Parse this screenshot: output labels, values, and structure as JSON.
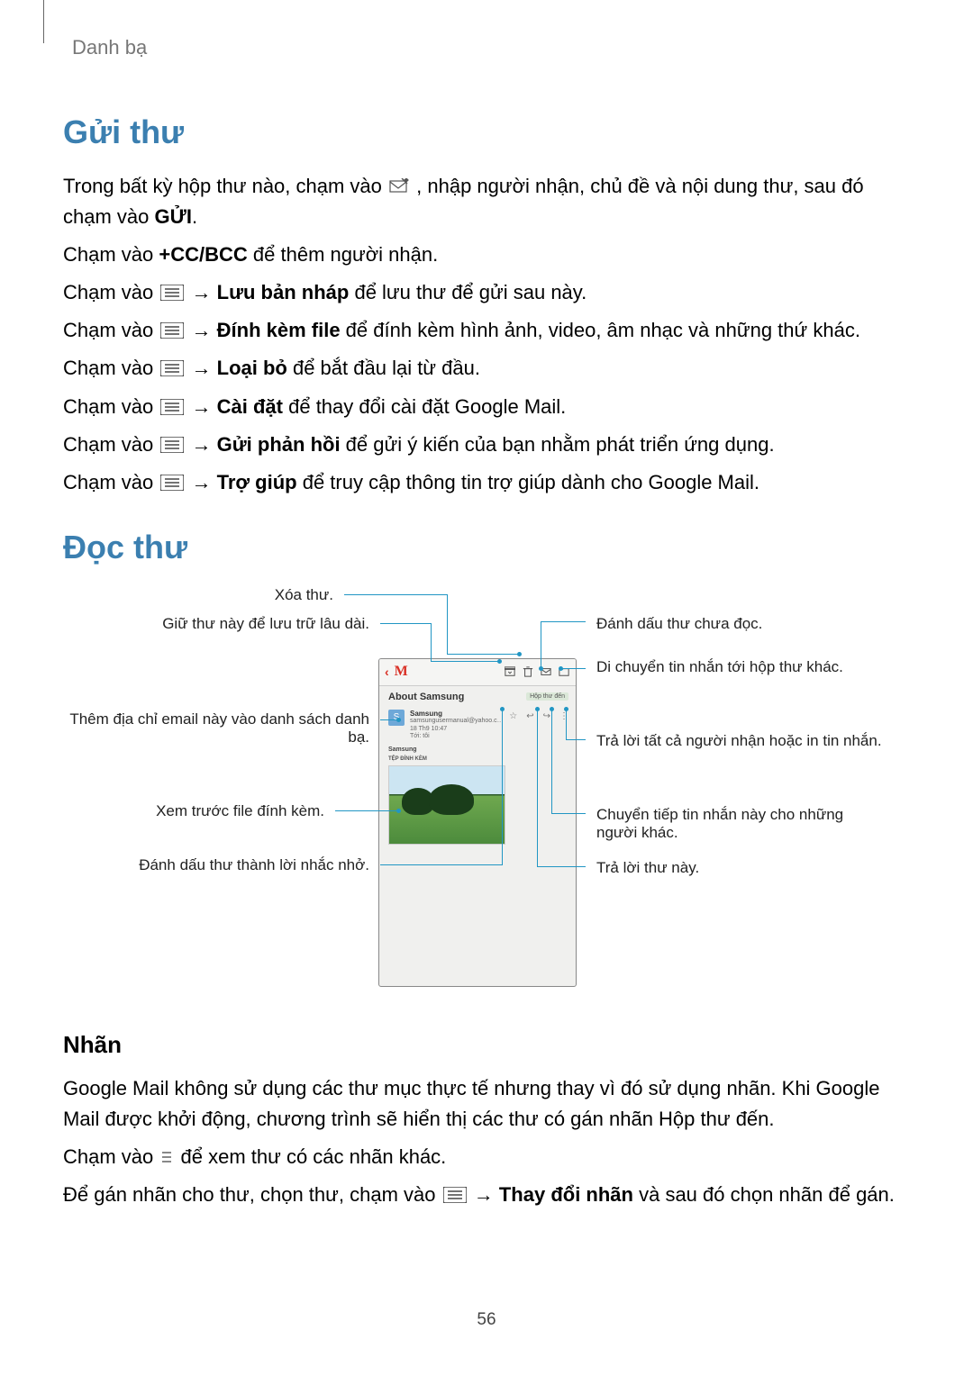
{
  "breadcrumb": "Danh bạ",
  "section1_title": "Gửi thư",
  "s1_p1a": "Trong bất kỳ hộp thư nào, chạm vào ",
  "s1_p1b": ", nhập người nhận, chủ đề và nội dung thư, sau đó chạm vào ",
  "s1_p1c": "GỬI",
  "s1_p1d": ".",
  "s1_p2a": "Chạm vào ",
  "s1_p2b": "+CC/BCC",
  "s1_p2c": " để thêm người nhận.",
  "s1_p3a": "Chạm vào ",
  "arrow": " → ",
  "s1_p3b": "Lưu bản nháp",
  "s1_p3c": " để lưu thư để gửi sau này.",
  "s1_p4b": "Đính kèm file",
  "s1_p4c": " để đính kèm hình ảnh, video, âm nhạc và những thứ khác.",
  "s1_p5b": "Loại bỏ",
  "s1_p5c": " để bắt đầu lại từ đầu.",
  "s1_p6b": "Cài đặt",
  "s1_p6c": " để thay đổi cài đặt Google Mail.",
  "s1_p7b": "Gửi phản hồi",
  "s1_p7c": " để gửi ý kiến của bạn nhằm phát triển ứng dụng.",
  "s1_p8b": "Trợ giúp",
  "s1_p8c": " để truy cập thông tin trợ giúp dành cho Google Mail.",
  "section2_title": "Đọc thư",
  "callouts": {
    "l1": "Xóa thư.",
    "l2": "Giữ thư này để lưu trữ lâu dài.",
    "l3": "Thêm địa chỉ email này vào danh sách danh bạ.",
    "l4": "Xem trước file đính kèm.",
    "l5": "Đánh dấu thư thành lời nhắc nhở.",
    "r1": "Đánh dấu thư chưa đọc.",
    "r2": "Di chuyển tin nhắn tới hộp thư khác.",
    "r3": "Trả lời tất cả người nhận hoặc in tin nhắn.",
    "r4": "Chuyển tiếp tin nhắn này cho những người khác.",
    "r5": "Trả lời thư này."
  },
  "phone": {
    "subject": "About Samsung",
    "inbox_chip": "Hộp thư đến",
    "sender_name": "Samsung",
    "sender_email": "samsungusermanual@yahoo.c…",
    "sender_date": "18 Th9 10:47",
    "sender_to": "Tới: tôi",
    "body_line1": "Samsung",
    "attach_label": "TỆP ĐÍNH KÈM"
  },
  "section3_title": "Nhãn",
  "s3_p1": "Google Mail không sử dụng các thư mục thực tế nhưng thay vì đó sử dụng nhãn. Khi Google Mail được khởi động, chương trình sẽ hiển thị các thư có gán nhãn Hộp thư đến.",
  "s3_p2a": "Chạm vào ",
  "s3_p2b": " để xem thư có các nhãn khác.",
  "s3_p3a": "Để gán nhãn cho thư, chọn thư, chạm vào ",
  "s3_p3b": "Thay đổi nhãn",
  "s3_p3c": " và sau đó chọn nhãn để gán.",
  "page_number": "56"
}
